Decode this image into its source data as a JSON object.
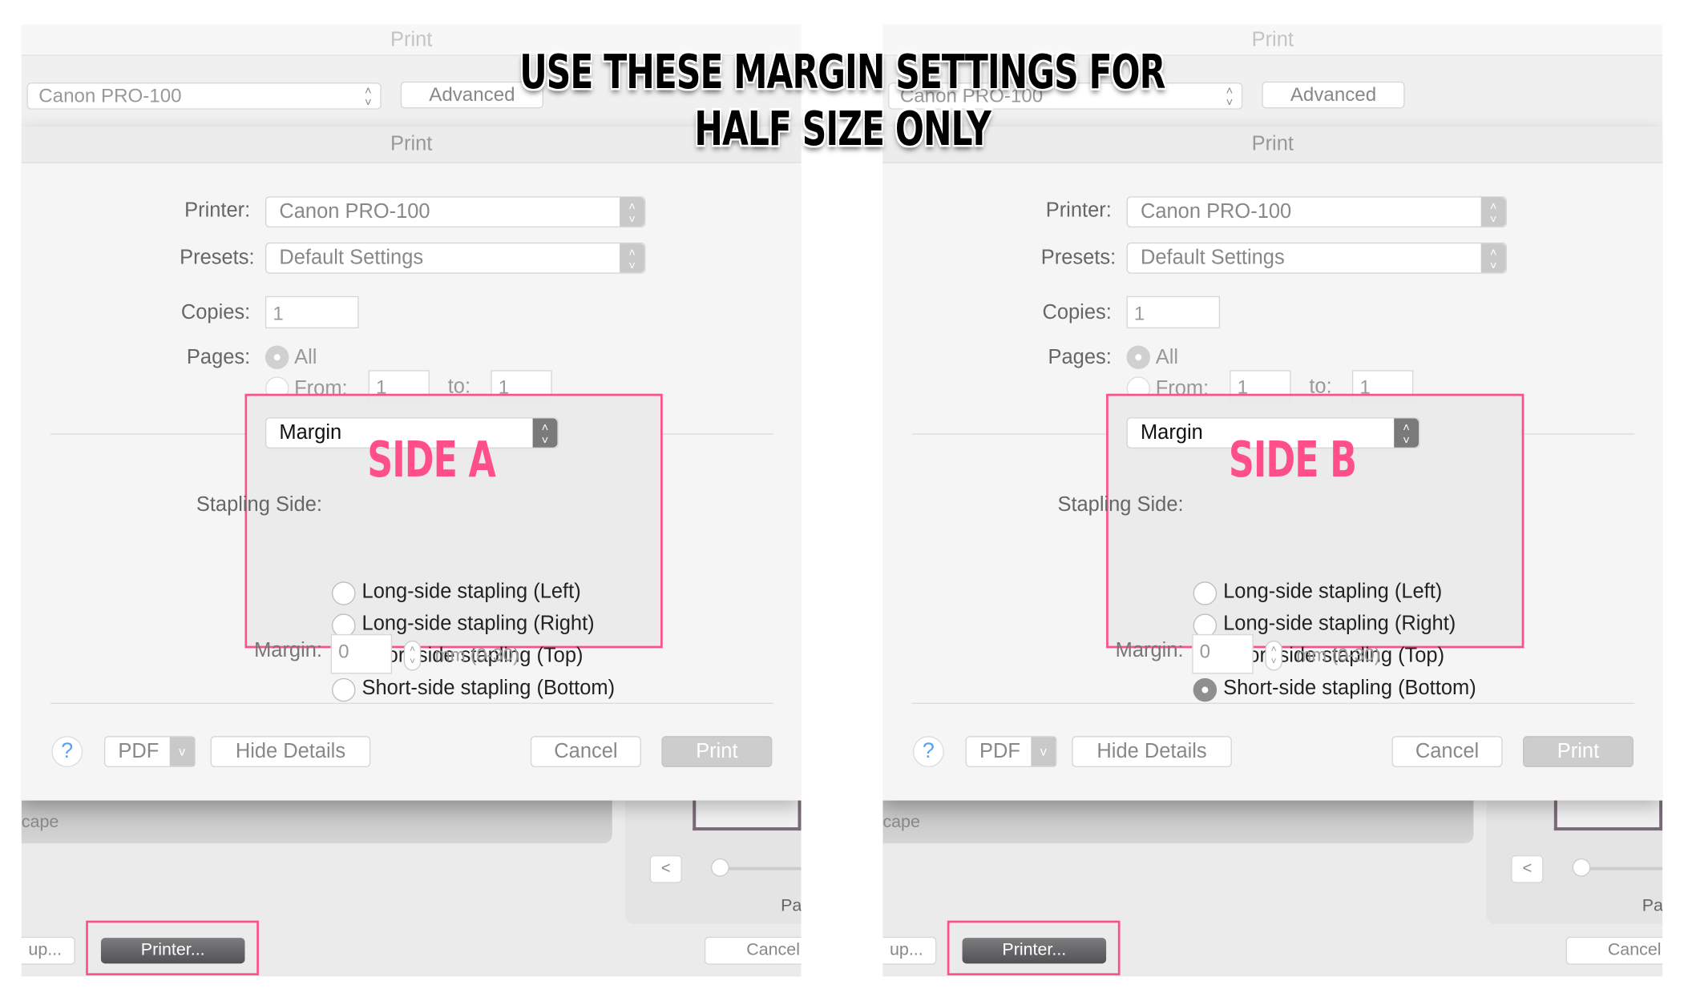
{
  "headline": {
    "line1": "USE THESE MARGIN SETTINGS FOR",
    "line2": "HALF SIZE ONLY"
  },
  "accent_color": "#ff4f8b",
  "panels": [
    {
      "side_label": "SIDE A",
      "selected_stapling": 2,
      "bg_window": {
        "title": "Print",
        "printer": "Canon PRO-100",
        "advanced": "Advanced"
      },
      "sheet_title": "Print",
      "printer_label": "Printer:",
      "printer_value": "Canon PRO-100",
      "presets_label": "Presets:",
      "presets_value": "Default Settings",
      "copies_label": "Copies:",
      "copies_value": "1",
      "pages_label": "Pages:",
      "pages_all": "All",
      "pages_from": "From:",
      "from_value": "1",
      "to_label": "to:",
      "to_value": "1",
      "section_popup": "Margin",
      "stapling_label": "Stapling Side:",
      "stapling_options": [
        "Long-side stapling (Left)",
        "Long-side stapling (Right)",
        "Short-side stapling (Top)",
        "Short-side stapling (Bottom)"
      ],
      "margin_label": "Margin:",
      "margin_value": "0",
      "margin_unit": "mm (0-30)",
      "buttons": {
        "help": "?",
        "pdf": "PDF",
        "hide_details": "Hide Details",
        "cancel": "Cancel",
        "print": "Print"
      },
      "behind": {
        "cape": "cape",
        "prev": "<",
        "pa": "Pa",
        "setup": "up...",
        "printer": "Printer...",
        "cancel": "Cancel"
      }
    },
    {
      "side_label": "SIDE B",
      "selected_stapling": 3,
      "bg_window": {
        "title": "Print",
        "printer": "Canon PRO-100",
        "advanced": "Advanced"
      },
      "sheet_title": "Print",
      "printer_label": "Printer:",
      "printer_value": "Canon PRO-100",
      "presets_label": "Presets:",
      "presets_value": "Default Settings",
      "copies_label": "Copies:",
      "copies_value": "1",
      "pages_label": "Pages:",
      "pages_all": "All",
      "pages_from": "From:",
      "from_value": "1",
      "to_label": "to:",
      "to_value": "1",
      "section_popup": "Margin",
      "stapling_label": "Stapling Side:",
      "stapling_options": [
        "Long-side stapling (Left)",
        "Long-side stapling (Right)",
        "Short-side stapling (Top)",
        "Short-side stapling (Bottom)"
      ],
      "margin_label": "Margin:",
      "margin_value": "0",
      "margin_unit": "mm (0-30)",
      "buttons": {
        "help": "?",
        "pdf": "PDF",
        "hide_details": "Hide Details",
        "cancel": "Cancel",
        "print": "Print"
      },
      "behind": {
        "cape": "cape",
        "prev": "<",
        "pa": "Pa",
        "setup": "up...",
        "printer": "Printer...",
        "cancel": "Cancel"
      }
    }
  ]
}
